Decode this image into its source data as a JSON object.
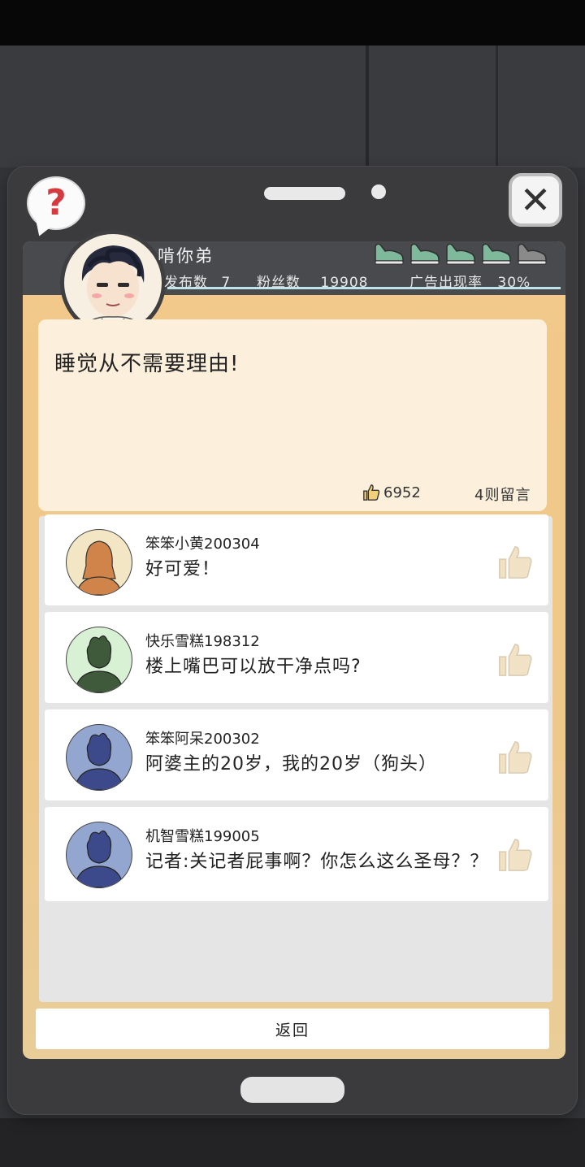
{
  "profile": {
    "username": "啃你弟",
    "posts_label": "发布数",
    "posts_value": "7",
    "fans_label": "粉丝数",
    "fans_value": "19908",
    "ad_label": "广告出现率",
    "ad_value": "30%",
    "rating_shoes_filled": 4,
    "rating_shoes_total": 5
  },
  "post": {
    "text": "睡觉从不需要理由!",
    "likes": "6952",
    "comments_count": "4则留言"
  },
  "comments": [
    {
      "name": "笨笨小黄200304",
      "text": "好可爱！",
      "avatar_bg": "#f2e6c4",
      "avatar_fg": "#d0844a",
      "avatar_type": "female"
    },
    {
      "name": "快乐雪糕198312",
      "text": "楼上嘴巴可以放干净点吗?",
      "avatar_bg": "#d8f0d4",
      "avatar_fg": "#3f5a3a",
      "avatar_type": "male"
    },
    {
      "name": "笨笨阿呆200302",
      "text": "阿婆主的20岁，我的20岁（狗头）",
      "avatar_bg": "#93a6cf",
      "avatar_fg": "#3c4a8c",
      "avatar_type": "male"
    },
    {
      "name": "机智雪糕199005",
      "text": "记者:关记者屁事啊？你怎么这么圣母？？",
      "avatar_bg": "#93a6cf",
      "avatar_fg": "#3c4a8c",
      "avatar_type": "male"
    }
  ],
  "buttons": {
    "back": "返回",
    "help_icon": "?",
    "close_icon": "✕"
  },
  "colors": {
    "screen_orange": "#f2c98a",
    "shoe_green": "#7fb99b",
    "shoe_gray": "#8a8a8a",
    "like_icon": "#f1e2c6"
  }
}
